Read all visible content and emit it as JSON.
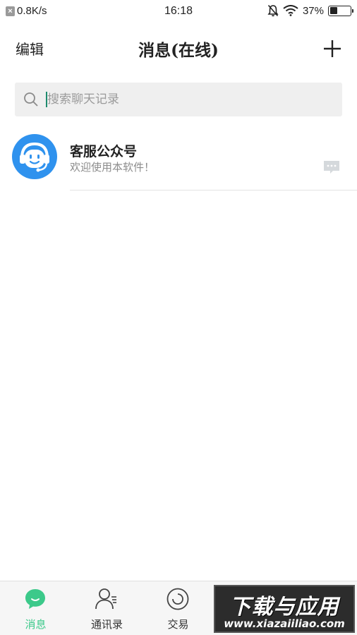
{
  "status_bar": {
    "network_speed": "0.8K/s",
    "time": "16:18",
    "battery_percent": "37%",
    "battery_level": 0.37
  },
  "header": {
    "edit_label": "编辑",
    "title": "消息(在线)"
  },
  "search": {
    "placeholder": "搜索聊天记录"
  },
  "conversations": [
    {
      "name": "客服公众号",
      "preview": "欢迎使用本软件！"
    }
  ],
  "bottom_nav": [
    {
      "label": "消息",
      "icon": "chat-bubble-icon",
      "active": true
    },
    {
      "label": "通讯录",
      "icon": "contacts-icon",
      "active": false
    },
    {
      "label": "交易",
      "icon": "trade-circle-icon",
      "active": false
    }
  ],
  "watermark": {
    "brand": "下载与应用",
    "url": "www.xiazaiiliao.com"
  },
  "colors": {
    "accent": "#3cc98a",
    "avatar_bg": "#2f92ee",
    "search_bg": "#efefef"
  }
}
